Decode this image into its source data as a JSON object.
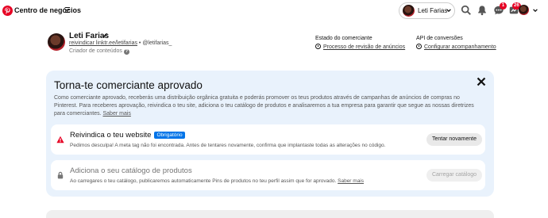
{
  "topbar": {
    "brand": "Centro de negócios",
    "account_name": "Leti Farias",
    "messages_badge": "1",
    "updates_badge": "26"
  },
  "profile": {
    "name": "Leti Farias",
    "link": "reivindicar linktr.ee/letifarias",
    "separator": " • ",
    "handle": "@letifarias_",
    "role": "Criador de conteúdos"
  },
  "merchant_status": {
    "heading": "Estado do comerciante",
    "link": "Processo de revisão de anúncios"
  },
  "conversions_api": {
    "heading": "API de conversões",
    "link": "Configurar acompanhamento"
  },
  "panel": {
    "title": "Torna-te comerciante aprovado",
    "description": "Como comerciante aprovado, receberás uma distribuição orgânica gratuita e poderás promover os teus produtos através de campanhas de anúncios de compras no Pinterest. Para receberes aprovação, reivindica o teu site, adiciona o teu catálogo de produtos e analisaremos a tua empresa para garantir que segue as nossas diretrizes para comerciantes.",
    "learn_more": "Saber mais"
  },
  "cards": [
    {
      "title": "Reivindica o teu website",
      "badge": "Obrigatório",
      "subtitle": "Pedimos desculpa! A meta tag não foi encontrada. Antes de tentares novamente, confirma que implantaste todas as alterações no código.",
      "button": "Tentar novamente",
      "icon": "warning-icon"
    },
    {
      "title": "Adiciona o seu catálogo de produtos",
      "subtitle": "Ao carregares o teu catálogo, publicaremos automaticamente Pins de produtos no teu perfil assim que for aprovado.",
      "learn_more": "Saber mais",
      "button": "Carregar catálogo",
      "icon": "lock-icon"
    }
  ],
  "colors": {
    "pinterest_red": "#e60023",
    "panel_bg": "#e9f2fc",
    "required_badge": "#0074e8",
    "warning": "#e60023"
  }
}
